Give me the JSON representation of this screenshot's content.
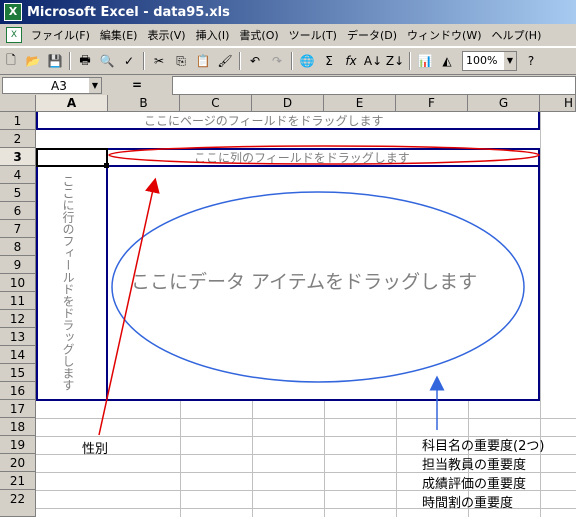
{
  "window": {
    "title": "Microsoft Excel - data95.xls"
  },
  "menu": [
    "ファイル(F)",
    "編集(E)",
    "表示(V)",
    "挿入(I)",
    "書式(O)",
    "ツール(T)",
    "データ(D)",
    "ウィンドウ(W)",
    "ヘルプ(H)"
  ],
  "toolbar": {
    "zoom": "100%"
  },
  "formula_bar": {
    "cell_ref": "A3",
    "equals": "="
  },
  "columns": [
    "A",
    "B",
    "C",
    "D",
    "E",
    "F",
    "G",
    "H"
  ],
  "rows": [
    "1",
    "2",
    "3",
    "4",
    "5",
    "6",
    "7",
    "8",
    "9",
    "10",
    "11",
    "12",
    "13",
    "14",
    "15",
    "16",
    "17",
    "18",
    "19",
    "20",
    "21",
    "22"
  ],
  "pivot": {
    "page_placeholder": "ここにページのフィールドをドラッグします",
    "column_placeholder": "ここに列のフィールドをドラッグします",
    "row_placeholder": "ここに行のフィールドをドラッグします",
    "data_placeholder": "ここにデータ アイテムをドラッグします"
  },
  "annotations": {
    "gender": "性別",
    "importance_1": "科目名の重要度(2つ)",
    "importance_2": "担当教員の重要度",
    "importance_3": "成績評価の重要度",
    "importance_4": "時間割の重要度"
  },
  "colors": {
    "ellipse_red": "#e00000",
    "ellipse_blue": "#3366dd",
    "arrow_red": "#e00000",
    "arrow_blue": "#3366dd",
    "frame": "#000080"
  }
}
